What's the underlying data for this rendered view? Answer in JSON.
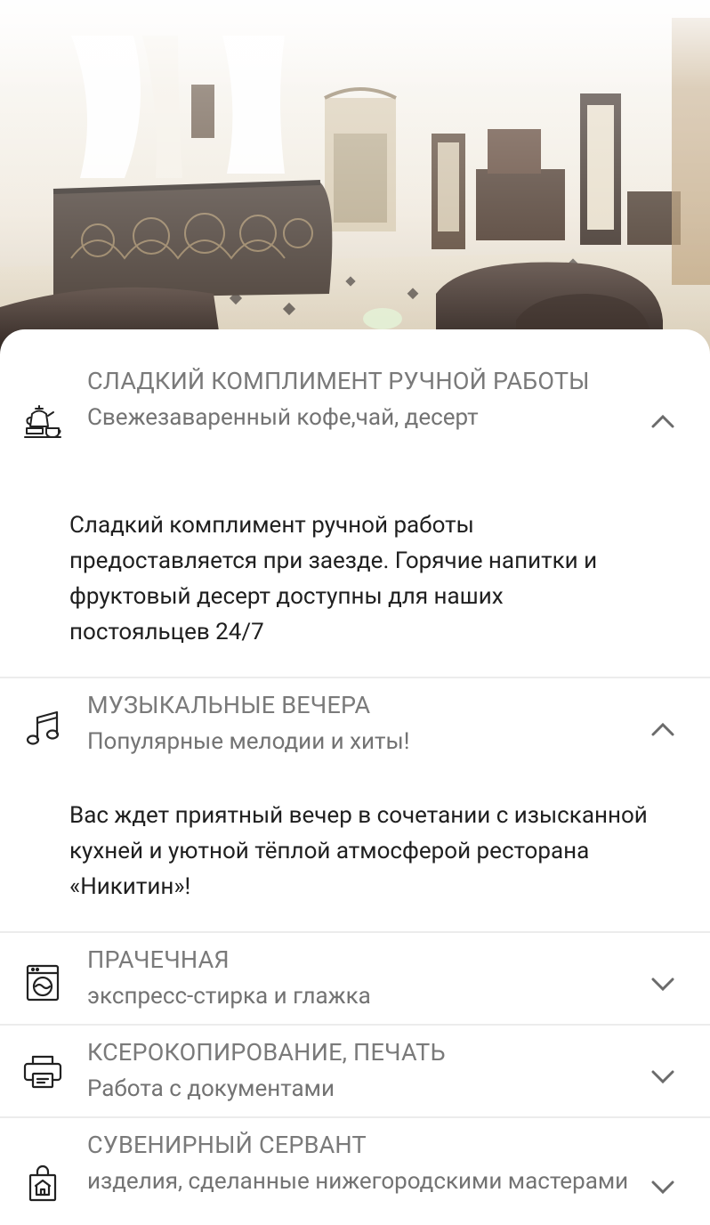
{
  "hero": {
    "image": "hotel-lobby-photo"
  },
  "services": [
    {
      "icon": "teapot-cup-icon",
      "title": "СЛАДКИЙ КОМПЛИМЕНТ РУЧНОЙ РАБОТЫ",
      "subtitle": "Свежезаваренный кофе,чай, десерт",
      "expanded": true,
      "description": "Сладкий комплимент ручной работы предоставляется при заезде. Горячие напитки и фруктовый десерт доступны для наших постояльцев 24/7"
    },
    {
      "icon": "music-note-icon",
      "title": "МУЗЫКАЛЬНЫЕ ВЕЧЕРА",
      "subtitle": "Популярные мелодии и хиты!",
      "expanded": true,
      "description": "Вас ждет приятный вечер в сочетании с изысканной кухней и уютной тёплой атмосферой ресторана «Никитин»!"
    },
    {
      "icon": "washing-machine-icon",
      "title": "ПРАЧЕЧНАЯ",
      "subtitle": "экспресс-стирка и глажка",
      "expanded": false
    },
    {
      "icon": "printer-icon",
      "title": "КСЕРОКОПИРОВАНИЕ, ПЕЧАТЬ",
      "subtitle": "Работа с документами",
      "expanded": false
    },
    {
      "icon": "shopping-bag-icon",
      "title": "СУВЕНИРНЫЙ СЕРВАНТ",
      "subtitle": "изделия, сделанные нижегородскими мастерами",
      "expanded": false
    }
  ],
  "colors": {
    "title": "#7a7a7a",
    "subtitle": "#737373",
    "body": "#1f1f1f",
    "divider": "#ececec"
  }
}
